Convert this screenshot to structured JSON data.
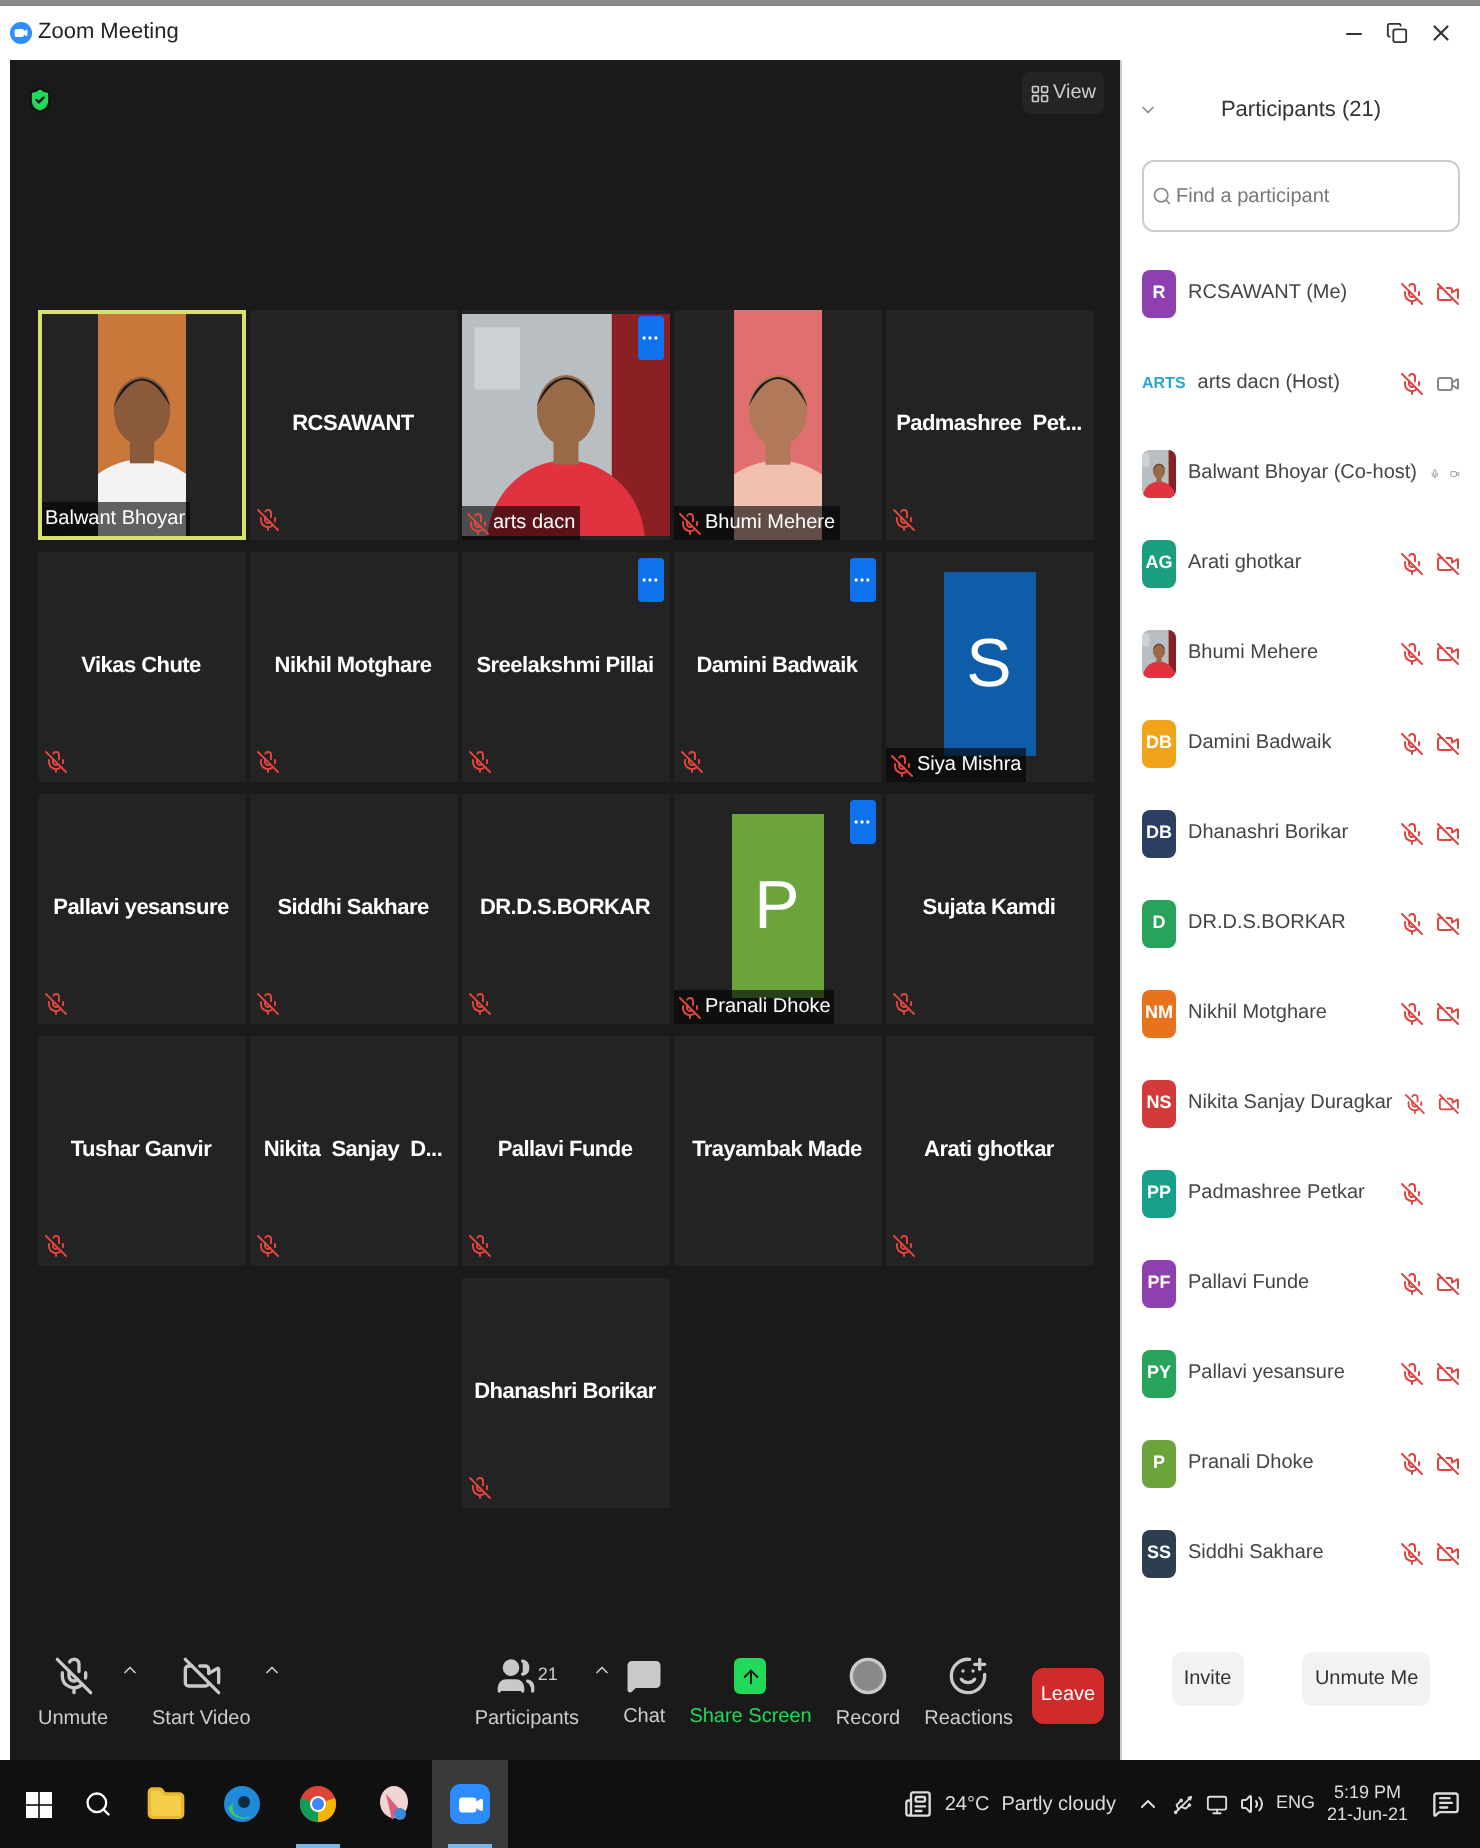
{
  "window": {
    "title": "Zoom Meeting"
  },
  "view_button": {
    "label": "View"
  },
  "rows": [
    [
      {
        "kind": "phone_video",
        "name": "Balwant Bhoyar",
        "muted": false,
        "more": false,
        "speaking": true
      },
      {
        "kind": "name",
        "name": "RCSAWANT",
        "muted": true,
        "more": false,
        "speaking": false
      },
      {
        "kind": "video",
        "name": "arts dacn",
        "muted": true,
        "more": true,
        "speaking": false
      },
      {
        "kind": "phone_video",
        "name": "Bhumi Mehere",
        "muted": true,
        "more": false,
        "speaking": false
      },
      {
        "kind": "name",
        "name": "Padmashree  Pet...",
        "muted": true,
        "more": false,
        "speaking": false
      }
    ],
    [
      {
        "kind": "name",
        "name": "Vikas Chute",
        "muted": true,
        "more": false,
        "speaking": false
      },
      {
        "kind": "name",
        "name": "Nikhil Motghare",
        "muted": true,
        "more": false,
        "speaking": false
      },
      {
        "kind": "name",
        "name": "Sreelakshmi Pillai",
        "muted": true,
        "more": true,
        "speaking": false
      },
      {
        "kind": "name",
        "name": "Damini Badwaik",
        "muted": true,
        "more": true,
        "speaking": false
      },
      {
        "kind": "avatar",
        "name": "Siya Mishra",
        "letter": "S",
        "color": "#0f5ca8",
        "muted": true,
        "more": false,
        "speaking": false
      }
    ],
    [
      {
        "kind": "name",
        "name": "Pallavi yesansure",
        "muted": true,
        "more": false,
        "speaking": false
      },
      {
        "kind": "name",
        "name": "Siddhi Sakhare",
        "muted": true,
        "more": false,
        "speaking": false
      },
      {
        "kind": "name",
        "name": "DR.D.S.BORKAR",
        "muted": true,
        "more": false,
        "speaking": false
      },
      {
        "kind": "avatar",
        "name": "Pranali Dhoke",
        "letter": "P",
        "color": "#6aa43a",
        "muted": true,
        "more": true,
        "speaking": false
      },
      {
        "kind": "name",
        "name": "Sujata Kamdi",
        "muted": true,
        "more": false,
        "speaking": false
      }
    ],
    [
      {
        "kind": "name",
        "name": "Tushar Ganvir",
        "muted": true,
        "more": false,
        "speaking": false
      },
      {
        "kind": "name",
        "name": "Nikita  Sanjay  D...",
        "muted": true,
        "more": false,
        "speaking": false
      },
      {
        "kind": "name",
        "name": "Pallavi Funde",
        "muted": true,
        "more": false,
        "speaking": false
      },
      {
        "kind": "name",
        "name": "Trayambak Made",
        "muted": false,
        "more": false,
        "speaking": false
      },
      {
        "kind": "name",
        "name": "Arati ghotkar",
        "muted": true,
        "more": false,
        "speaking": false
      }
    ],
    [
      {
        "kind": "name",
        "name": "Dhanashri Borikar",
        "muted": true,
        "more": false,
        "speaking": false
      }
    ]
  ],
  "toolbar": {
    "items": [
      {
        "kind": "mic",
        "label": "Unmute",
        "caret": true
      },
      {
        "kind": "video",
        "label": "Start Video",
        "caret": true
      },
      {
        "kind": "participants",
        "label": "Participants",
        "count": "21",
        "caret": true
      },
      {
        "kind": "chat",
        "label": "Chat",
        "caret": false
      },
      {
        "kind": "share",
        "label": "Share Screen",
        "caret": false
      },
      {
        "kind": "record",
        "label": "Record",
        "caret": false
      },
      {
        "kind": "reactions",
        "label": "Reactions",
        "caret": false
      }
    ],
    "leave": "Leave"
  },
  "participants_panel": {
    "title": "Participants (21)",
    "search": {
      "placeholder": "Find a participant"
    },
    "participants": [
      {
        "name": "RCSAWANT (Me)",
        "avatar": {
          "kind": "initials",
          "text": "R",
          "color": "#8e3fb0"
        },
        "muted": true,
        "video_off": true
      },
      {
        "name": "arts dacn (Host)",
        "avatar": {
          "kind": "logo",
          "text": "ARTS",
          "color": "#29a8c8"
        },
        "muted": true,
        "video_off": false
      },
      {
        "name": "Balwant Bhoyar (Co-host)",
        "muted": false,
        "video_off": false
      },
      {
        "name": "Arati ghotkar",
        "avatar": {
          "kind": "initials",
          "text": "AG",
          "color": "#1b9e7e"
        },
        "muted": true,
        "video_off": true
      },
      {
        "name": "Bhumi Mehere",
        "muted": true,
        "video_off": true
      },
      {
        "name": "Damini Badwaik",
        "avatar": {
          "kind": "initials",
          "text": "DB",
          "color": "#f0a41c"
        },
        "muted": true,
        "video_off": true
      },
      {
        "name": "Dhanashri Borikar",
        "avatar": {
          "kind": "initials",
          "text": "DB",
          "color": "#2b3f63"
        },
        "muted": true,
        "video_off": true
      },
      {
        "name": "DR.D.S.BORKAR",
        "avatar": {
          "kind": "initials",
          "text": "D",
          "color": "#27a35c"
        },
        "muted": true,
        "video_off": true
      },
      {
        "name": "Nikhil Motghare",
        "avatar": {
          "kind": "initials",
          "text": "NM",
          "color": "#e8731c"
        },
        "muted": true,
        "video_off": true
      },
      {
        "name": "Nikita Sanjay Duragkar",
        "avatar": {
          "kind": "initials",
          "text": "NS",
          "color": "#d43a3a"
        },
        "muted": true,
        "video_off": true
      },
      {
        "name": "Padmashree Petkar",
        "avatar": {
          "kind": "initials",
          "text": "PP",
          "color": "#17a08c"
        },
        "muted": true
      },
      {
        "name": "Pallavi Funde",
        "avatar": {
          "kind": "initials",
          "text": "PF",
          "color": "#8e3fb0"
        },
        "muted": true,
        "video_off": true
      },
      {
        "name": "Pallavi yesansure",
        "avatar": {
          "kind": "initials",
          "text": "PY",
          "color": "#27a35c"
        },
        "muted": true,
        "video_off": true
      },
      {
        "name": "Pranali Dhoke",
        "avatar": {
          "kind": "initials",
          "text": "P",
          "color": "#6aa43a"
        },
        "muted": true,
        "video_off": true
      },
      {
        "name": "Siddhi Sakhare",
        "avatar": {
          "kind": "initials",
          "text": "SS",
          "color": "#2c3e50"
        },
        "muted": true,
        "video_off": true
      }
    ],
    "buttons": [
      "Invite",
      "Unmute Me"
    ]
  },
  "taskbar": {
    "apps": [
      {
        "kind": "folder",
        "running": false,
        "active": false
      },
      {
        "kind": "edge",
        "running": false,
        "active": false
      },
      {
        "kind": "chrome",
        "running": true,
        "active": false
      },
      {
        "kind": "paint",
        "running": false,
        "active": false
      },
      {
        "kind": "zoom",
        "running": true,
        "active": true
      }
    ],
    "temperature": "24°C",
    "weather": "Partly cloudy",
    "language": "ENG",
    "time": "5:19 PM",
    "date": "21-Jun-21"
  }
}
